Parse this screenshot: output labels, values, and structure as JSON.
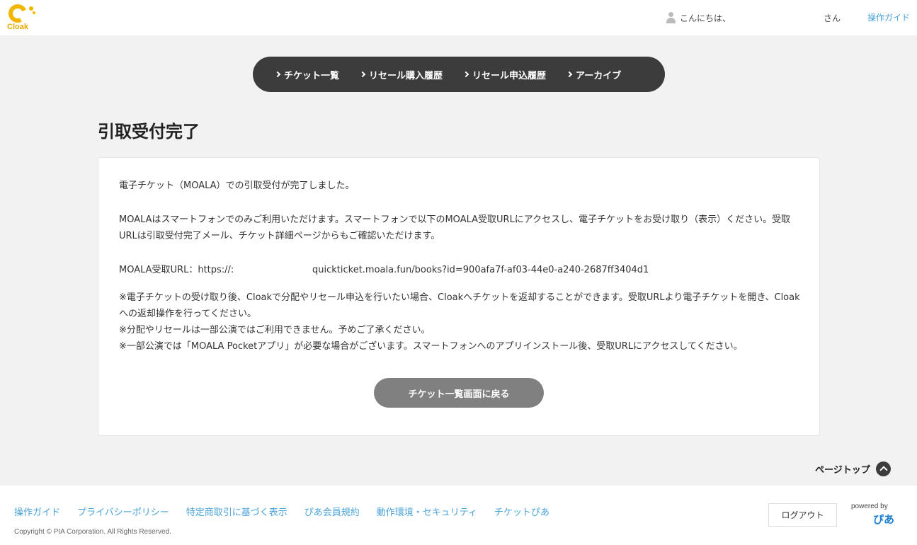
{
  "header": {
    "logo_text": "Cloak",
    "greeting": "こんにちは、",
    "san": "さん",
    "guide_link": "操作ガイド"
  },
  "nav": {
    "items": [
      {
        "label": "チケット一覧"
      },
      {
        "label": "リセール購入履歴"
      },
      {
        "label": "リセール申込履歴"
      },
      {
        "label": "アーカイブ"
      }
    ]
  },
  "main": {
    "title": "引取受付完了",
    "paragraph1": "電子チケット（MOALA）での引取受付が完了しました。",
    "paragraph2": "MOALAはスマートフォンでのみご利用いただけます。スマートフォンで以下のMOALA受取URLにアクセスし、電子チケットをお受け取り（表示）ください。受取URLは引取受付完了メール、チケット詳細ページからもご確認いただけます。",
    "url_label": "MOALA受取URL：https://:",
    "url_value": "quickticket.moala.fun/books?id=900afa7f-af03-44e0-a240-2687ff3404d1",
    "notes": [
      "※電子チケットの受け取り後、Cloakで分配やリセール申込を行いたい場合、Cloakへチケットを返却することができます。受取URLより電子チケットを開き、Cloakへの返却操作を行ってください。",
      "※分配やリセールは一部公演ではご利用できません。予めご了承ください。",
      "※一部公演では「MOALA Pocketアプリ」が必要な場合がございます。スマートフォンへのアプリインストール後、受取URLにアクセスしてください。"
    ],
    "back_button": "チケット一覧画面に戻る"
  },
  "pagetop": {
    "label": "ページトップ"
  },
  "footer": {
    "links": [
      {
        "label": "操作ガイド"
      },
      {
        "label": "プライバシーポリシー"
      },
      {
        "label": "特定商取引に基づく表示"
      },
      {
        "label": "ぴあ会員規約"
      },
      {
        "label": "動作環境・セキュリティ"
      },
      {
        "label": "チケットぴあ"
      }
    ],
    "copyright": "Copyright © PIA Corporation. All Rights Reserved.",
    "logout": "ログアウト",
    "powered_by": "powered by",
    "pia_logo": "ぴあ"
  },
  "colors": {
    "accent": "#f2b600",
    "link": "#4aa3d8",
    "nav_bg": "#3c3c3c",
    "button_bg": "#808080"
  }
}
